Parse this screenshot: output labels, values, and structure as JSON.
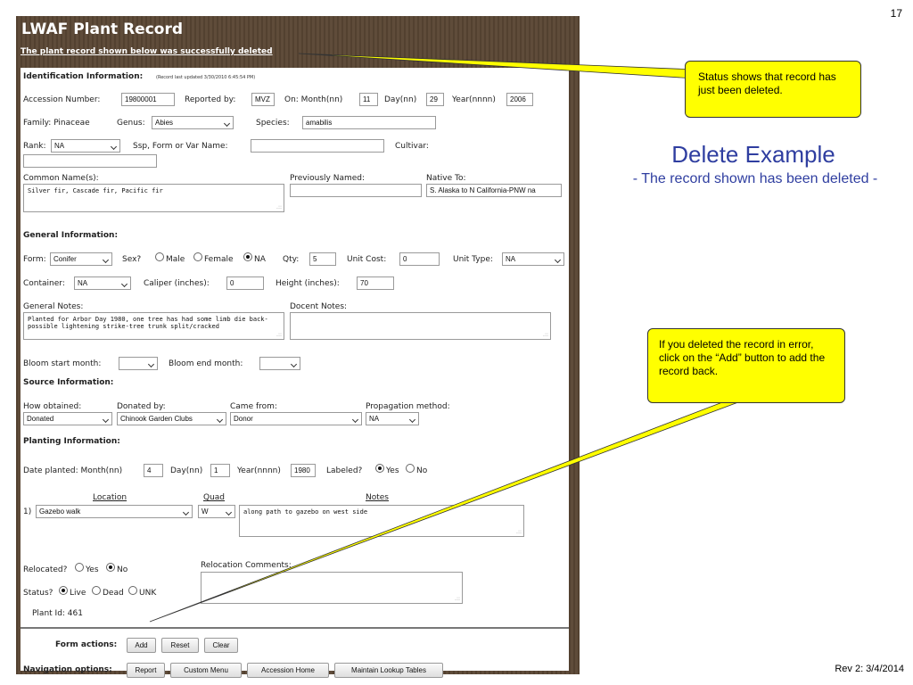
{
  "slide": {
    "number": "17",
    "title": "Delete Example",
    "subtitle": "- The record shown has been deleted -",
    "footer": "Rev 2: 3/4/2014",
    "callout_status": "Status shows that record has just been deleted.",
    "callout_add": "If you deleted the record in error, click on the “Add” button to add the record back."
  },
  "app": {
    "title": "LWAF Plant Record",
    "status_message": "The plant record shown below was successfully deleted"
  },
  "identification": {
    "heading": "Identification Information:",
    "last_updated": "(Record last updated 3/30/2010 6:45:54 PM)",
    "accession_label": "Accession Number:",
    "accession_value": "19800001",
    "reported_by_label": "Reported by:",
    "reported_by_value": "MVZ",
    "on_month_label": "On: Month(nn)",
    "month_value": "11",
    "day_label": "Day(nn)",
    "day_value": "29",
    "year_label": "Year(nnnn)",
    "year_value": "2006",
    "family_label": "Family: Pinaceae",
    "genus_label": "Genus:",
    "genus_value": "Abies",
    "species_label": "Species:",
    "species_value": "amabilis",
    "rank_label": "Rank:",
    "rank_value": "NA",
    "ssp_label": "Ssp, Form or Var Name:",
    "ssp_value": "",
    "cultivar_label": "Cultivar:",
    "cultivar_value": "",
    "common_names_label": "Common Name(s):",
    "common_names_value": "Silver fir, Cascade fir, Pacific fir",
    "previously_named_label": "Previously Named:",
    "previously_named_value": "",
    "native_to_label": "Native To:",
    "native_to_value": "S. Alaska to N California-PNW na"
  },
  "general": {
    "heading": "General Information:",
    "form_label": "Form:",
    "form_value": "Conifer",
    "sex_label": "Sex?",
    "male_label": "Male",
    "female_label": "Female",
    "na_label": "NA",
    "qty_label": "Qty:",
    "qty_value": "5",
    "unit_cost_label": "Unit Cost:",
    "unit_cost_value": "0",
    "unit_type_label": "Unit Type:",
    "unit_type_value": "NA",
    "container_label": "Container:",
    "container_value": "NA",
    "caliper_label": "Caliper (inches):",
    "caliper_value": "0",
    "height_label": "Height (inches):",
    "height_value": "70",
    "general_notes_label": "General Notes:",
    "general_notes_value": "Planted for Arbor Day 1980, one tree has had some limb die back-possible lightening strike-tree trunk split/cracked",
    "docent_notes_label": "Docent Notes:",
    "docent_notes_value": "",
    "bloom_start_label": "Bloom start month:",
    "bloom_start_value": "",
    "bloom_end_label": "Bloom end month:",
    "bloom_end_value": ""
  },
  "source": {
    "heading": "Source Information:",
    "how_obtained_label": "How obtained:",
    "how_obtained_value": "Donated",
    "donated_by_label": "Donated by:",
    "donated_by_value": "Chinook Garden Clubs",
    "came_from_label": "Came from:",
    "came_from_value": "Donor",
    "propagation_label": "Propagation method:",
    "propagation_value": "NA"
  },
  "planting": {
    "heading": "Planting Information:",
    "date_planted_label": "Date planted: Month(nn)",
    "month_value": "4",
    "day_label": "Day(nn)",
    "day_value": "1",
    "year_label": "Year(nnnn)",
    "year_value": "1980",
    "labeled_label": "Labeled?",
    "yes_label": "Yes",
    "no_label": "No",
    "location_header": "Location",
    "quad_header": "Quad",
    "notes_header": "Notes",
    "row_number": "1)",
    "location_value": "Gazebo walk",
    "quad_value": "W",
    "notes_value": "along path to gazebo on west side",
    "relocated_label": "Relocated?",
    "relocation_comments_label": "Relocation Comments:",
    "relocation_comments_value": "",
    "status_label": "Status?",
    "live_label": "Live",
    "dead_label": "Dead",
    "unk_label": "UNK",
    "plant_id_label": "Plant Id: 461"
  },
  "actions": {
    "form_actions_label": "Form actions:",
    "add": "Add",
    "reset": "Reset",
    "clear": "Clear",
    "navigation_label": "Navigation options:",
    "report": "Report",
    "custom_menu": "Custom Menu",
    "accession_home": "Accession Home",
    "maintain_lookup": "Maintain Lookup Tables"
  }
}
